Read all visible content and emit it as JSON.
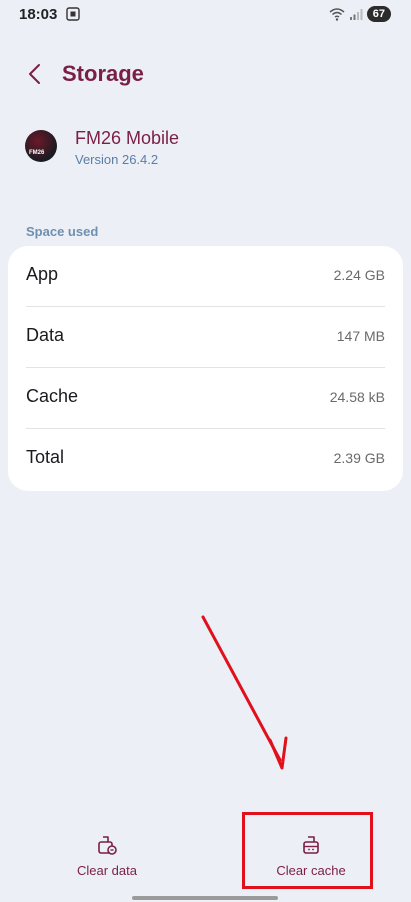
{
  "status_bar": {
    "time": "18:03",
    "battery": "67"
  },
  "header": {
    "title": "Storage"
  },
  "app": {
    "name": "FM26 Mobile",
    "version": "Version 26.4.2",
    "icon_text": "FM26"
  },
  "section": {
    "label": "Space used"
  },
  "storage_rows": [
    {
      "label": "App",
      "value": "2.24 GB"
    },
    {
      "label": "Data",
      "value": "147 MB"
    },
    {
      "label": "Cache",
      "value": "24.58 kB"
    },
    {
      "label": "Total",
      "value": "2.39 GB"
    }
  ],
  "bottom_actions": {
    "clear_data": "Clear data",
    "clear_cache": "Clear cache"
  },
  "colors": {
    "accent": "#7a1f45",
    "annotation": "#e0101c",
    "background": "#eceff5"
  }
}
